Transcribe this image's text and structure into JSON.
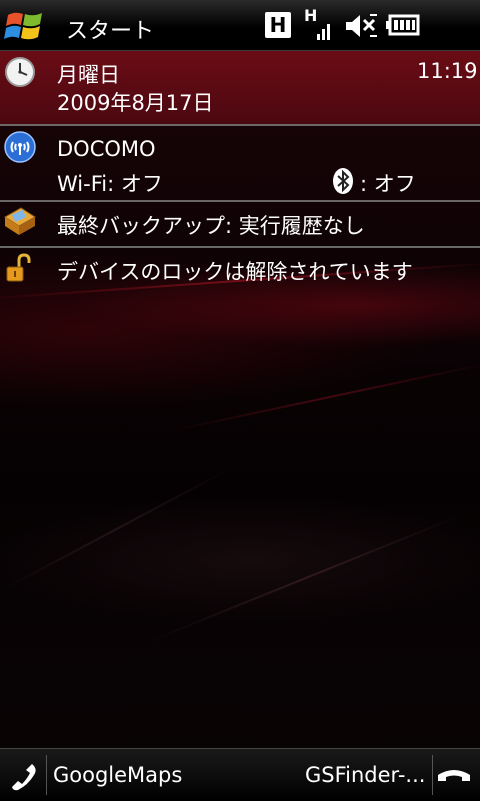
{
  "status_bar": {
    "start_label": "スタート",
    "network_type": "H",
    "signal_type_label": "H",
    "icons": [
      "windows-flag-icon",
      "hsdpa-icon",
      "signal-strength-icon",
      "speaker-mute-icon",
      "battery-icon"
    ]
  },
  "today": {
    "date_item": {
      "day": "月曜日",
      "date": "2009年8月17日",
      "time": "11:19"
    },
    "connection_item": {
      "carrier": "DOCOMO",
      "wifi": "Wi-Fi: オフ",
      "bluetooth": ": オフ"
    },
    "backup_item": {
      "label": "最終バックアップ: 実行履歴なし"
    },
    "lock_item": {
      "label": "デバイスのロックは解除されています"
    }
  },
  "soft_keys": {
    "left": "GoogleMaps",
    "right": "GSFinder-..."
  },
  "colors": {
    "accent_row": "#5a0a12",
    "background": "#000000",
    "text": "#ffffff"
  }
}
